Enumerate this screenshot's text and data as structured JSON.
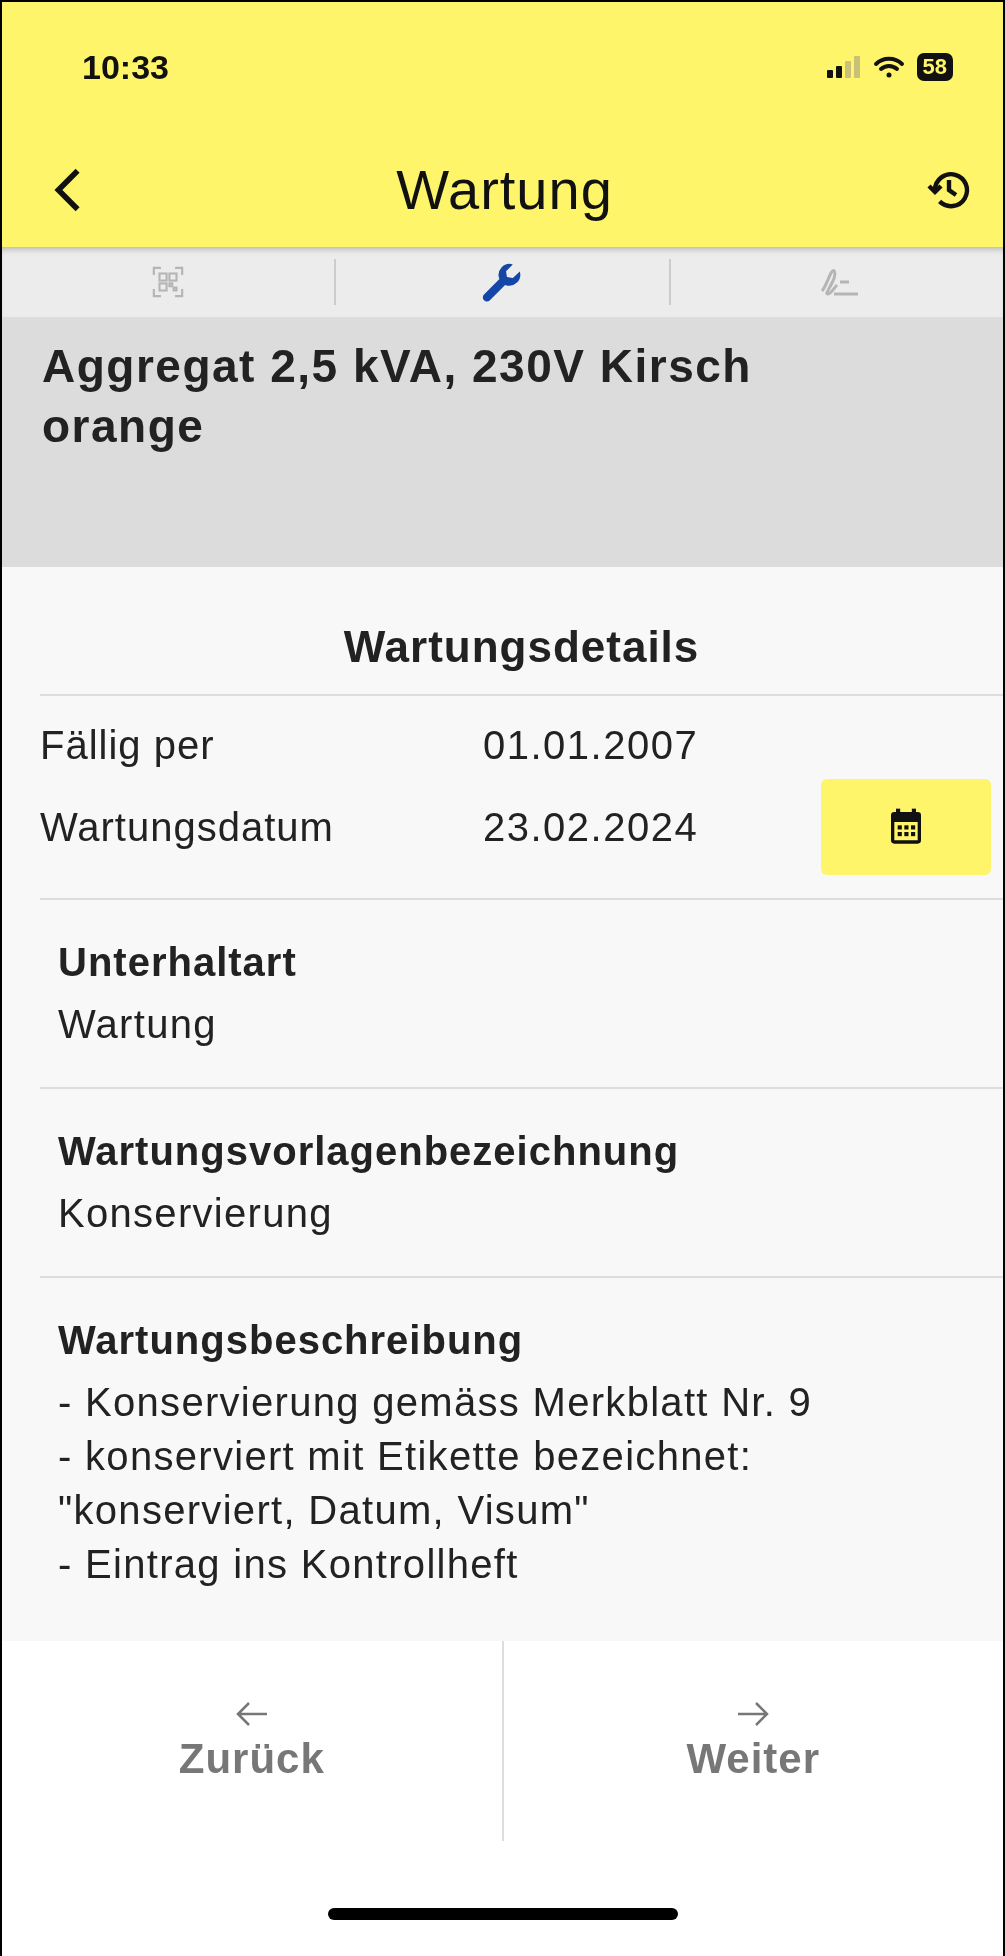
{
  "status_bar": {
    "time": "10:33",
    "battery": "58"
  },
  "header": {
    "title": "Wartung"
  },
  "steps": [
    {
      "kind": "scan",
      "selected": false
    },
    {
      "kind": "maintenance",
      "selected": true
    },
    {
      "kind": "signature",
      "selected": false
    }
  ],
  "item_title": "Aggregat 2,5 kVA, 230V Kirsch orange",
  "details": {
    "heading": "Wartungsdetails",
    "rows": [
      {
        "label": "Fällig per",
        "value": "01.01.2007",
        "kind": "text"
      },
      {
        "label": "Wartungsdatum",
        "value": "23.02.2024",
        "kind": "date"
      }
    ]
  },
  "sections": [
    {
      "label": "Unterhaltart",
      "lines": [
        "Wartung"
      ]
    },
    {
      "label": "Wartungsvorlagenbezeichnung",
      "lines": [
        "Konservierung"
      ]
    },
    {
      "label": "Wartungsbeschreibung",
      "lines": [
        "- Konservierung gemäss Merkblatt Nr. 9",
        "- konserviert mit Etikette bezeichnet: \"konserviert, Datum, Visum\"",
        "- Eintrag ins Kontrollheft"
      ]
    }
  ],
  "footer": {
    "back": "Zurück",
    "next": "Weiter"
  }
}
